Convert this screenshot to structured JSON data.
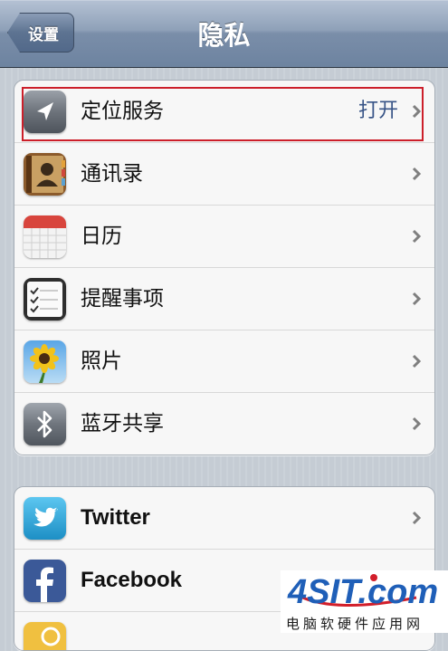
{
  "nav": {
    "back_label": "设置",
    "title": "隐私"
  },
  "group1": [
    {
      "label": "定位服务",
      "value": "打开",
      "icon": "location-arrow-icon"
    },
    {
      "label": "通讯录",
      "icon": "contacts-book-icon"
    },
    {
      "label": "日历",
      "icon": "calendar-icon"
    },
    {
      "label": "提醒事项",
      "icon": "reminders-icon"
    },
    {
      "label": "照片",
      "icon": "sunflower-photos-icon"
    },
    {
      "label": "蓝牙共享",
      "icon": "bluetooth-icon"
    }
  ],
  "group2": [
    {
      "label": "Twitter",
      "icon": "twitter-bird-icon"
    },
    {
      "label": "Facebook",
      "icon": "facebook-icon"
    },
    {
      "label": "",
      "icon": "partial-app-icon"
    }
  ],
  "watermark": {
    "logo": "4SIT.com",
    "text": "电脑软硬件应用网"
  },
  "colors": {
    "highlight": "#cc1f2a",
    "value_text": "#385487",
    "twitter": "#2aa3d8",
    "facebook": "#3b5998"
  }
}
